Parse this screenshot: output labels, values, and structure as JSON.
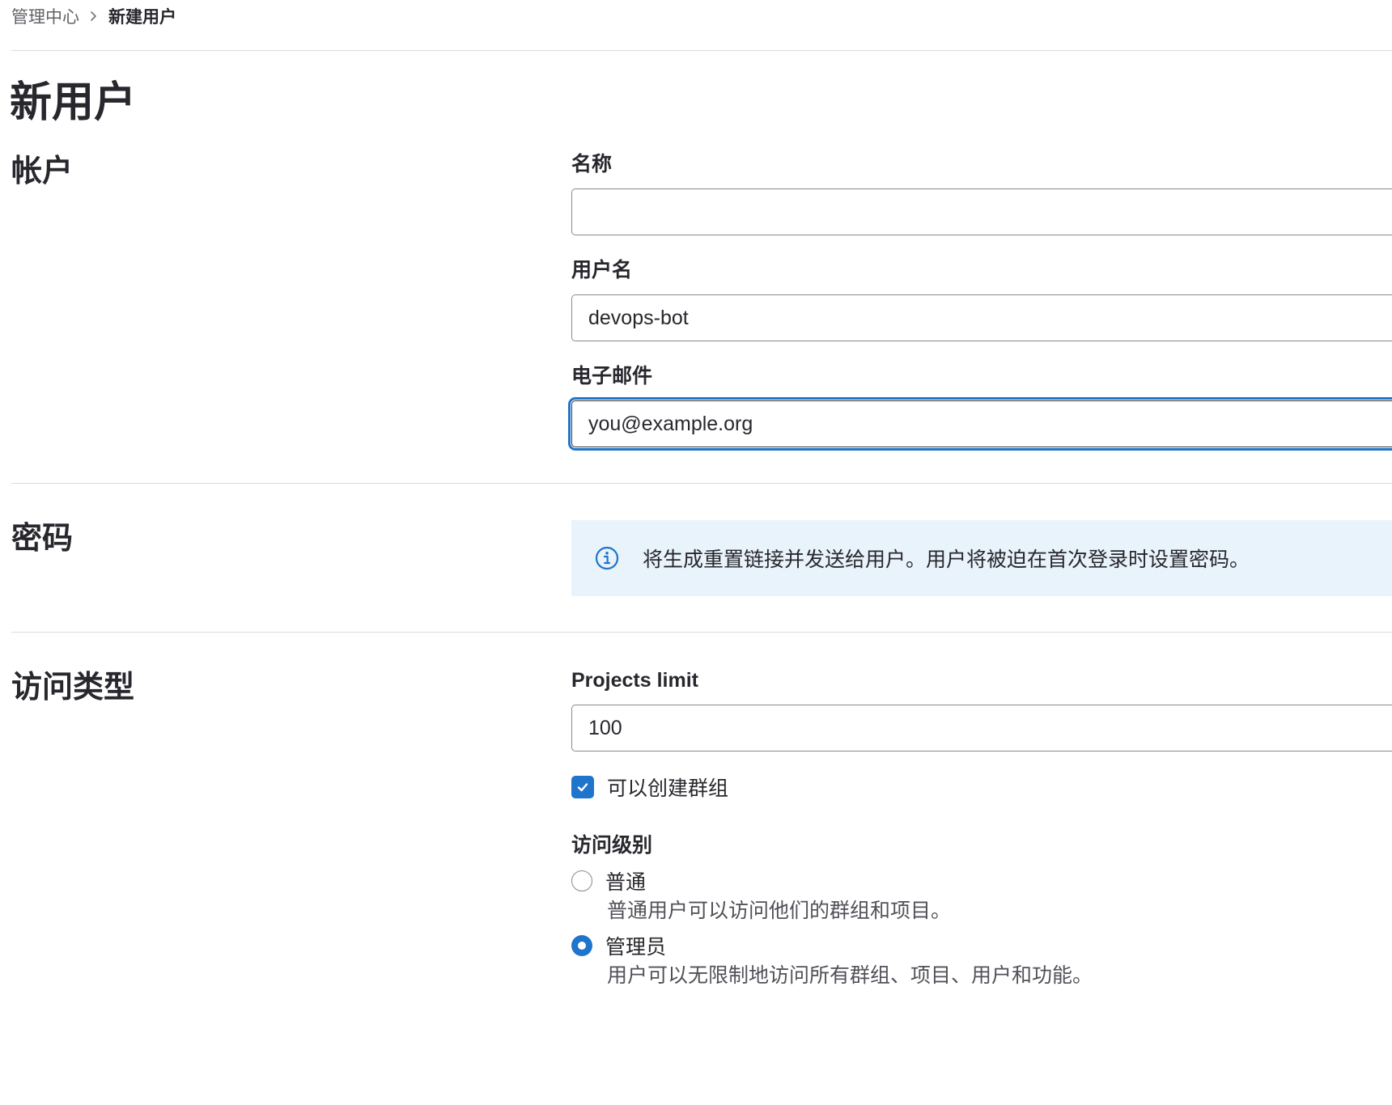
{
  "breadcrumb": {
    "parent": "管理中心",
    "current": "新建用户"
  },
  "page_title": "新用户",
  "account": {
    "section_title": "帐户",
    "name_label": "名称",
    "name_value": "",
    "username_label": "用户名",
    "username_value": "devops-bot",
    "email_label": "电子邮件",
    "email_value": "you@example.org"
  },
  "password": {
    "section_title": "密码",
    "info_icon": "info-circle-icon",
    "info_text": "将生成重置链接并发送给用户。用户将被迫在首次登录时设置密码。"
  },
  "access": {
    "section_title": "访问类型",
    "projects_limit_label": "Projects limit",
    "projects_limit_value": "100",
    "can_create_group_label": "可以创建群组",
    "can_create_group_checked": true,
    "access_level_label": "访问级别",
    "levels": [
      {
        "label": "普通",
        "description": "普通用户可以访问他们的群组和项目。",
        "selected": false
      },
      {
        "label": "管理员",
        "description": "用户可以无限制地访问所有群组、项目、用户和功能。",
        "selected": true
      }
    ]
  },
  "colors": {
    "accent": "#1f75cb",
    "info_background": "#e9f3fc",
    "divider": "#dcdcde",
    "text": "#28272d"
  }
}
